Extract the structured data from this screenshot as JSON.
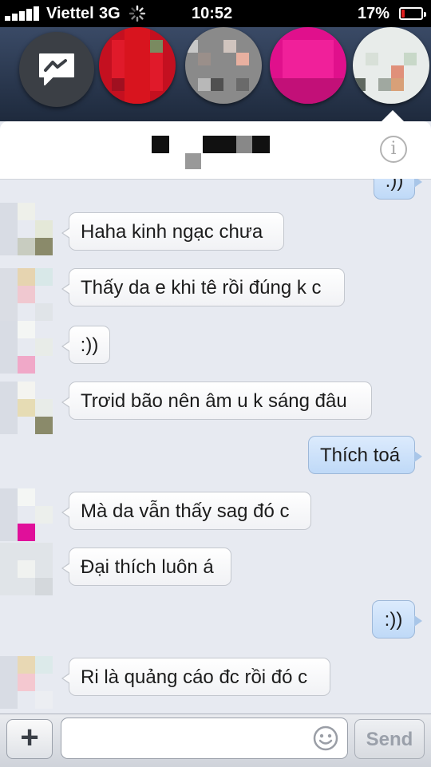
{
  "status_bar": {
    "carrier": "Viettel",
    "network": "3G",
    "time": "10:52",
    "battery_percent": "17%",
    "battery_level": 0.17,
    "icons": [
      "signal-icon",
      "activity-spinner-icon",
      "battery-icon"
    ]
  },
  "chat_heads": {
    "messenger_icon": "messenger-lightning-icon",
    "count": 4
  },
  "header": {
    "contact_name": "",
    "info_icon": "info-icon",
    "info_glyph": "i"
  },
  "messages": [
    {
      "direction": "out",
      "text": ":))"
    },
    {
      "direction": "in",
      "text": "Haha kinh ngạc chưa"
    },
    {
      "direction": "in",
      "text": "Thấy da e khi tê rồi đúng k c"
    },
    {
      "direction": "in",
      "text": ":))"
    },
    {
      "direction": "in",
      "text": "Trơid bão nên âm u k sáng đâu"
    },
    {
      "direction": "out",
      "text": "Thích toá"
    },
    {
      "direction": "in",
      "text": "Mà da vẫn thấy sag đó c"
    },
    {
      "direction": "in",
      "text": "Đại thích luôn á"
    },
    {
      "direction": "out",
      "text": ":))"
    },
    {
      "direction": "in",
      "text": "Ri là quảng cáo đc rồi đó c"
    }
  ],
  "composer": {
    "plus_label": "+",
    "input_value": "",
    "send_label": "Send",
    "smiley_icon": "smiley-icon"
  },
  "colors": {
    "outgoing_bubble": "#bfd9f7",
    "incoming_bubble": "#ffffff",
    "battery_low": "#e02020"
  }
}
